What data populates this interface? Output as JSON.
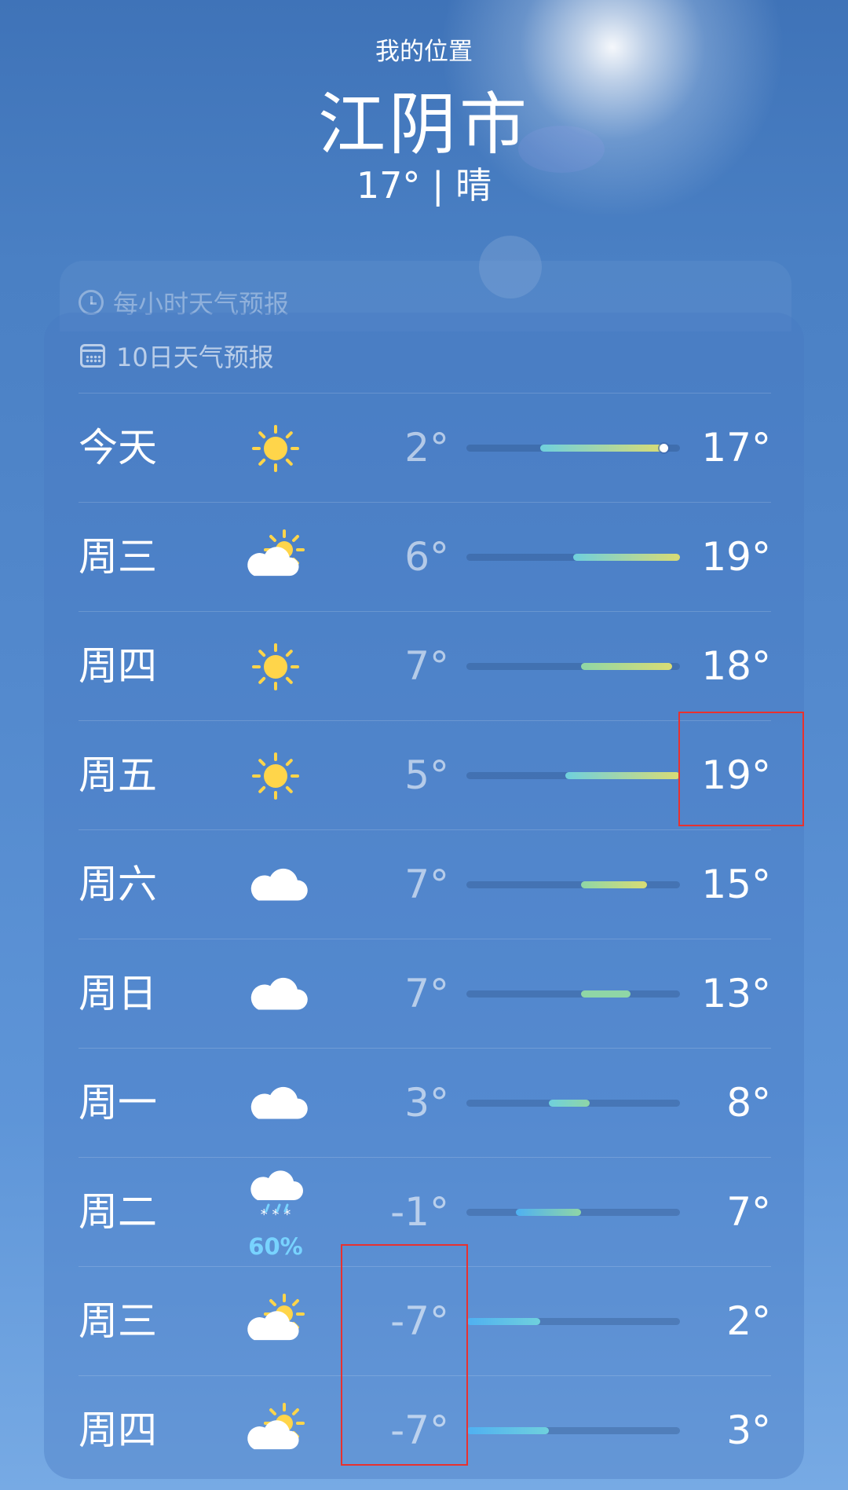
{
  "header": {
    "location_label": "我的位置",
    "city": "江阴市",
    "summary": "17° | 晴"
  },
  "hourly": {
    "title": "每小时天气预报",
    "icon": "clock-icon"
  },
  "forecast": {
    "title": "10日天气预报",
    "icon": "calendar-icon",
    "scale": {
      "min": -7,
      "max": 19
    },
    "current_temp": 17,
    "days": [
      {
        "day": "今天",
        "icon": "sun",
        "low": "2°",
        "high": "17°",
        "low_val": 2,
        "high_val": 17,
        "precip": ""
      },
      {
        "day": "周三",
        "icon": "partly-cloudy",
        "low": "6°",
        "high": "19°",
        "low_val": 6,
        "high_val": 19,
        "precip": ""
      },
      {
        "day": "周四",
        "icon": "sun",
        "low": "7°",
        "high": "18°",
        "low_val": 7,
        "high_val": 18,
        "precip": ""
      },
      {
        "day": "周五",
        "icon": "sun",
        "low": "5°",
        "high": "19°",
        "low_val": 5,
        "high_val": 19,
        "precip": ""
      },
      {
        "day": "周六",
        "icon": "cloud",
        "low": "7°",
        "high": "15°",
        "low_val": 7,
        "high_val": 15,
        "precip": ""
      },
      {
        "day": "周日",
        "icon": "cloud",
        "low": "7°",
        "high": "13°",
        "low_val": 7,
        "high_val": 13,
        "precip": ""
      },
      {
        "day": "周一",
        "icon": "cloud",
        "low": "3°",
        "high": "8°",
        "low_val": 3,
        "high_val": 8,
        "precip": ""
      },
      {
        "day": "周二",
        "icon": "cloud-snow",
        "low": "-1°",
        "high": "7°",
        "low_val": -1,
        "high_val": 7,
        "precip": "60%"
      },
      {
        "day": "周三",
        "icon": "partly-cloudy",
        "low": "-7°",
        "high": "2°",
        "low_val": -7,
        "high_val": 2,
        "precip": ""
      },
      {
        "day": "周四",
        "icon": "partly-cloudy",
        "low": "-7°",
        "high": "3°",
        "low_val": -7,
        "high_val": 3,
        "precip": ""
      }
    ]
  },
  "colors": {
    "bar_cold": "#4fb0f2",
    "bar_cool": "#6fd0dd",
    "bar_mild": "#8fd6a6",
    "bar_warm": "#d9dc74",
    "sun": "#ffd54a",
    "precip_text": "#78d3ff",
    "highlight": "#e8312f"
  }
}
